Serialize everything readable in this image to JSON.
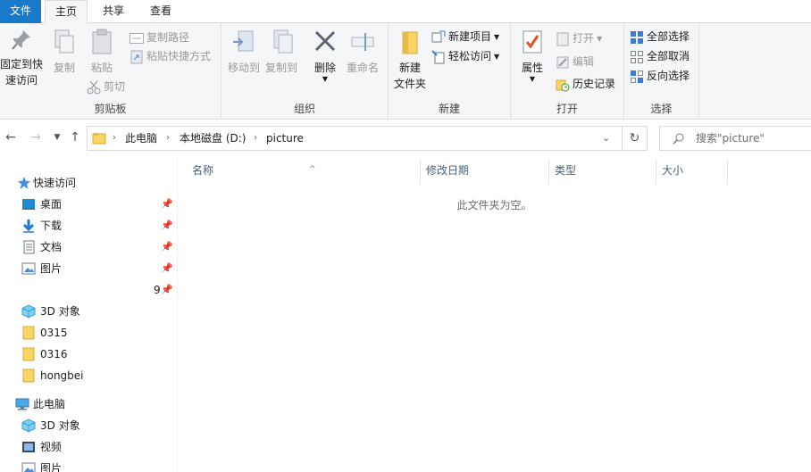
{
  "tabs": {
    "file": "文件",
    "home": "主页",
    "share": "共享",
    "view": "查看"
  },
  "ribbon": {
    "clipboard": {
      "label": "剪贴板",
      "pin_line1": "固定到快",
      "pin_line2": "速访问",
      "copy": "复制",
      "paste": "粘贴",
      "copy_path": "复制路径",
      "paste_shortcut": "粘贴快捷方式",
      "cut": "剪切"
    },
    "organize": {
      "label": "组织",
      "move_to": "移动到",
      "copy_to": "复制到",
      "delete": "删除",
      "rename": "重命名"
    },
    "new": {
      "label": "新建",
      "new_folder_line1": "新建",
      "new_folder_line2": "文件夹",
      "new_item": "新建项目",
      "easy_access": "轻松访问"
    },
    "open": {
      "label": "打开",
      "properties": "属性",
      "open": "打开",
      "edit": "编辑",
      "history": "历史记录"
    },
    "select": {
      "label": "选择",
      "select_all": "全部选择",
      "select_none": "全部取消",
      "invert": "反向选择"
    }
  },
  "address": {
    "crumbs": [
      "此电脑",
      "本地磁盘 (D:)",
      "picture"
    ],
    "search_placeholder": "搜索\"picture\""
  },
  "nav": {
    "quick_access": "快速访问",
    "items": [
      {
        "label": "桌面",
        "pinned": true
      },
      {
        "label": "下载",
        "pinned": true
      },
      {
        "label": "文档",
        "pinned": true
      },
      {
        "label": "图片",
        "pinned": true
      },
      {
        "label": "",
        "suffix": "9",
        "pinned": true
      },
      {
        "label": "3D 对象",
        "pinned": false
      },
      {
        "label": "0315",
        "pinned": false
      },
      {
        "label": "0316",
        "pinned": false
      },
      {
        "label": "hongbei",
        "pinned": false
      }
    ],
    "this_pc": "此电脑",
    "pc_items": [
      {
        "label": "3D 对象"
      },
      {
        "label": "视频"
      },
      {
        "label": "图片"
      }
    ]
  },
  "columns": {
    "name": "名称",
    "modified": "修改日期",
    "type": "类型",
    "size": "大小"
  },
  "empty_message": "此文件夹为空。",
  "colors": {
    "accent": "#1979ca",
    "folder": "#f9d664",
    "ribbon_bg": "#f5f6f7"
  }
}
